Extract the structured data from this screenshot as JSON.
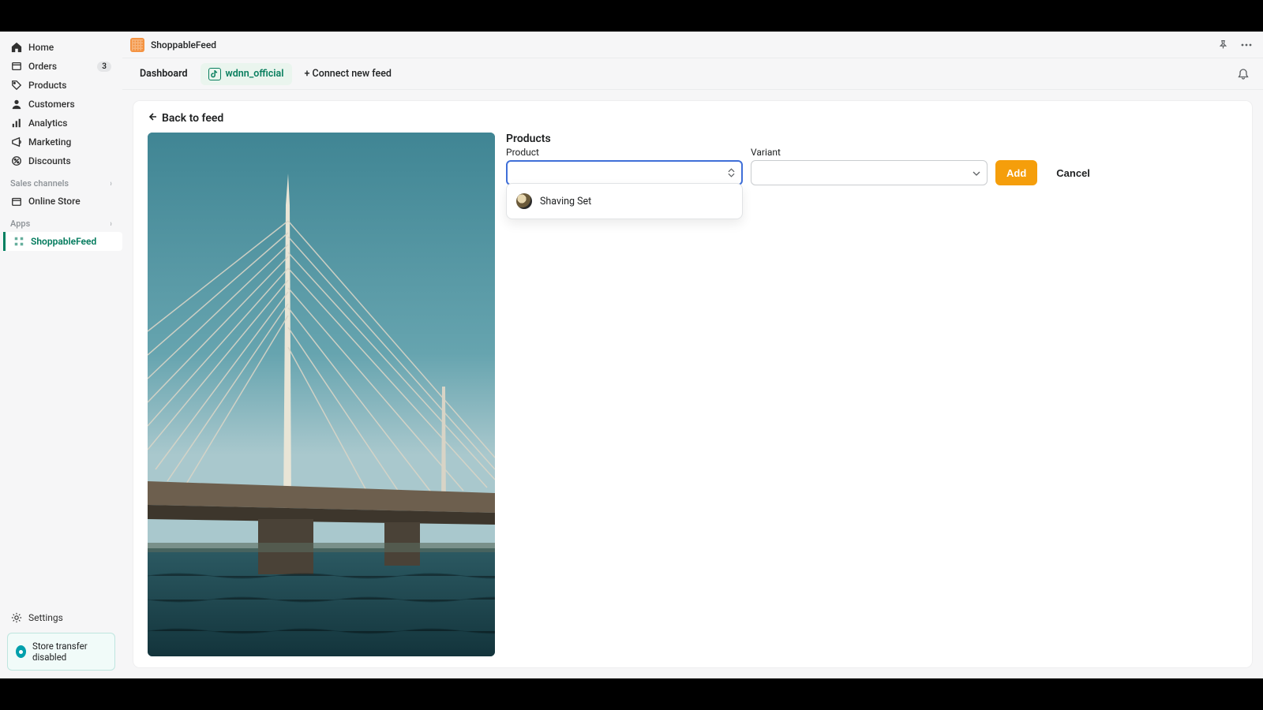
{
  "sidebar": {
    "items": [
      {
        "label": "Home",
        "icon": "home-icon"
      },
      {
        "label": "Orders",
        "icon": "orders-icon",
        "badge": "3"
      },
      {
        "label": "Products",
        "icon": "products-icon"
      },
      {
        "label": "Customers",
        "icon": "customers-icon"
      },
      {
        "label": "Analytics",
        "icon": "analytics-icon"
      },
      {
        "label": "Marketing",
        "icon": "marketing-icon"
      },
      {
        "label": "Discounts",
        "icon": "discounts-icon"
      }
    ],
    "sections": {
      "sales_channels": {
        "title": "Sales channels",
        "items": [
          {
            "label": "Online Store",
            "icon": "store-icon"
          }
        ]
      },
      "apps": {
        "title": "Apps",
        "items": [
          {
            "label": "ShoppableFeed",
            "active": true
          }
        ]
      }
    },
    "settings": {
      "label": "Settings"
    },
    "transfer_card": {
      "text": "Store transfer disabled"
    }
  },
  "topbar": {
    "app_name": "ShoppableFeed"
  },
  "tabs": {
    "dashboard": "Dashboard",
    "feed": "wdnn_official",
    "connect": "+ Connect new feed"
  },
  "page": {
    "back_label": "Back to feed",
    "products_title": "Products",
    "product_label": "Product",
    "variant_label": "Variant",
    "product_value": "",
    "variant_value": "",
    "add_label": "Add",
    "cancel_label": "Cancel",
    "dropdown": [
      {
        "label": "Shaving Set"
      }
    ]
  }
}
